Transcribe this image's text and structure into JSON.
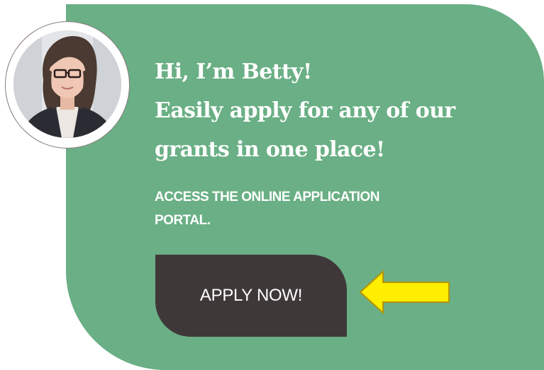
{
  "promo": {
    "headline_lines": [
      "Hi, I’m Betty!",
      "Easily apply for any of our",
      "grants in one place!"
    ],
    "subline_lines": [
      "ACCESS THE ONLINE APPLICATION",
      "PORTAL."
    ],
    "cta_label": "APPLY NOW!"
  },
  "colors": {
    "card_background": "#6aaf85",
    "button_background": "#3f3839",
    "arrow_fill": "#ffee00",
    "arrow_outline": "#b89400",
    "text": "#ffffff"
  },
  "icons": {
    "avatar": "profile-photo",
    "pointer": "left-arrow-icon"
  }
}
